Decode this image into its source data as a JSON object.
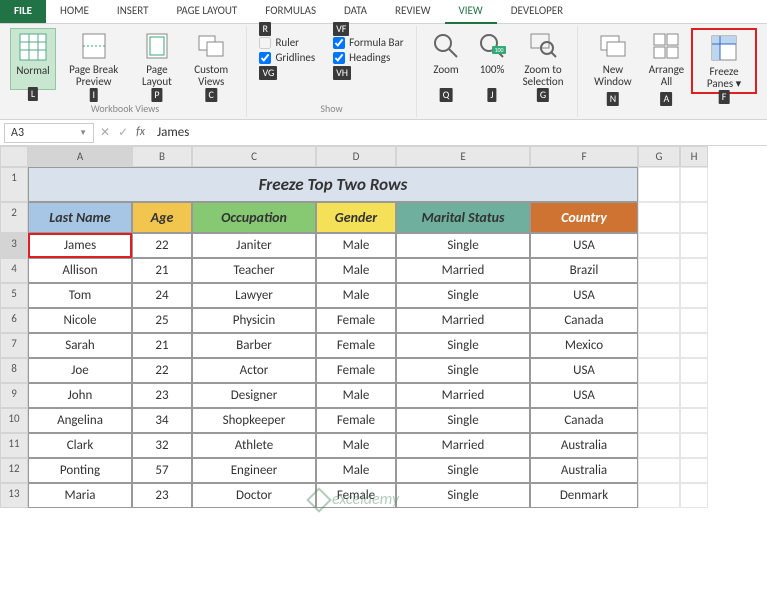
{
  "tabs": {
    "file": "FILE",
    "items": [
      "HOME",
      "INSERT",
      "PAGE LAYOUT",
      "FORMULAS",
      "DATA",
      "REVIEW",
      "VIEW",
      "DEVELOPER"
    ],
    "active": "VIEW"
  },
  "ribbon": {
    "views": {
      "normal": "Normal",
      "pagebreak": "Page Break Preview",
      "pagelayout": "Page Layout",
      "custom": "Custom Views",
      "group": "Workbook Views"
    },
    "show": {
      "ruler": "Ruler",
      "formula_bar": "Formula Bar",
      "gridlines": "Gridlines",
      "headings": "Headings",
      "group": "Show"
    },
    "zoom": {
      "zoom": "Zoom",
      "hundred": "100%",
      "selection": "Zoom to Selection"
    },
    "window": {
      "new": "New Window",
      "arrange": "Arrange All",
      "freeze": "Freeze Panes"
    },
    "keytips": {
      "L": "L",
      "I": "I",
      "P": "P",
      "C": "C",
      "R": "R",
      "VF": "VF",
      "VG": "VG",
      "VH": "VH",
      "Q": "Q",
      "J": "J",
      "G": "G",
      "N": "N",
      "A": "A",
      "F": "F"
    }
  },
  "namebox": "A3",
  "formula_value": "James",
  "columns": [
    "A",
    "B",
    "C",
    "D",
    "E",
    "F",
    "G",
    "H"
  ],
  "title": "Freeze Top Two Rows",
  "headers": [
    "Last Name",
    "Age",
    "Occupation",
    "Gender",
    "Marital Status",
    "Country"
  ],
  "rows": [
    {
      "n": 3,
      "d": [
        "James",
        "22",
        "Janiter",
        "Male",
        "Single",
        "USA"
      ]
    },
    {
      "n": 4,
      "d": [
        "Allison",
        "21",
        "Teacher",
        "Male",
        "Married",
        "Brazil"
      ]
    },
    {
      "n": 5,
      "d": [
        "Tom",
        "24",
        "Lawyer",
        "Male",
        "Single",
        "USA"
      ]
    },
    {
      "n": 6,
      "d": [
        "Nicole",
        "25",
        "Physicin",
        "Female",
        "Married",
        "Canada"
      ]
    },
    {
      "n": 7,
      "d": [
        "Sarah",
        "21",
        "Barber",
        "Female",
        "Single",
        "Mexico"
      ]
    },
    {
      "n": 8,
      "d": [
        "Joe",
        "22",
        "Actor",
        "Female",
        "Single",
        "USA"
      ]
    },
    {
      "n": 9,
      "d": [
        "John",
        "23",
        "Designer",
        "Male",
        "Married",
        "USA"
      ]
    },
    {
      "n": 10,
      "d": [
        "Angelina",
        "34",
        "Shopkeeper",
        "Female",
        "Single",
        "Canada"
      ]
    },
    {
      "n": 11,
      "d": [
        "Clark",
        "32",
        "Athlete",
        "Male",
        "Married",
        "Australia"
      ]
    },
    {
      "n": 12,
      "d": [
        "Ponting",
        "57",
        "Engineer",
        "Male",
        "Single",
        "Australia"
      ]
    },
    {
      "n": 13,
      "d": [
        "Maria",
        "23",
        "Doctor",
        "Female",
        "Single",
        "Denmark"
      ]
    }
  ],
  "watermark": "exceldemy"
}
